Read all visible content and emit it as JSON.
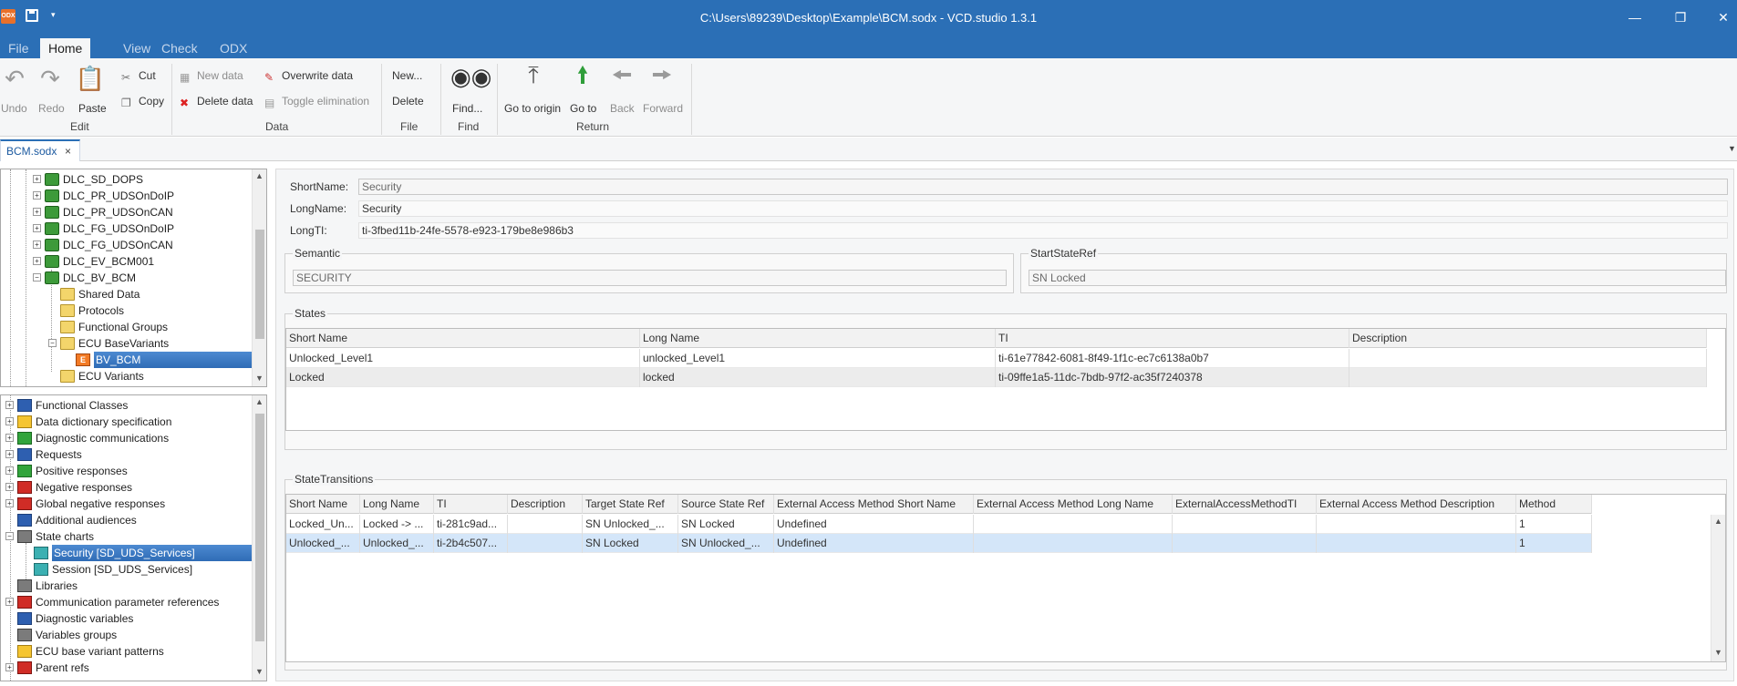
{
  "window": {
    "title": "C:\\Users\\89239\\Desktop\\Example\\BCM.sodx - VCD.studio 1.3.1",
    "icon_text": "ODX",
    "controls": [
      "minimize-icon",
      "restore-icon",
      "close-icon"
    ]
  },
  "menu": {
    "tabs": [
      "File",
      "Home",
      "View",
      "Check",
      "ODX"
    ],
    "active": "Home"
  },
  "ribbon": {
    "edit": {
      "label": "Edit",
      "undo": "Undo",
      "redo": "Redo",
      "paste": "Paste",
      "cut": "Cut",
      "copy": "Copy"
    },
    "data": {
      "label": "Data",
      "new_data": "New data",
      "delete_data": "Delete data",
      "overwrite_data": "Overwrite data",
      "toggle_elimination": "Toggle elimination"
    },
    "file": {
      "label": "File",
      "new": "New...",
      "delete": "Delete"
    },
    "find": {
      "label": "Find",
      "find": "Find..."
    },
    "return": {
      "label": "Return",
      "go_to_origin": "Go to origin",
      "go_to": "Go to",
      "back": "Back",
      "forward": "Forward"
    }
  },
  "doc_tab": {
    "label": "BCM.sodx",
    "close": "×"
  },
  "tree_top": {
    "items": [
      {
        "label": "DLC_SD_DOPS",
        "icon": "package-icon"
      },
      {
        "label": "DLC_PR_UDSOnDoIP",
        "icon": "package-icon"
      },
      {
        "label": "DLC_PR_UDSOnCAN",
        "icon": "package-icon"
      },
      {
        "label": "DLC_FG_UDSOnDoIP",
        "icon": "package-icon"
      },
      {
        "label": "DLC_FG_UDSOnCAN",
        "icon": "package-icon"
      },
      {
        "label": "DLC_EV_BCM001",
        "icon": "package-icon"
      },
      {
        "label": "DLC_BV_BCM",
        "icon": "package-icon"
      },
      {
        "label": "Shared Data",
        "icon": "folder-icon"
      },
      {
        "label": "Protocols",
        "icon": "folder-icon"
      },
      {
        "label": "Functional Groups",
        "icon": "folder-icon"
      },
      {
        "label": "ECU BaseVariants",
        "icon": "folder-icon"
      },
      {
        "label": "BV_BCM",
        "icon": "ecu-icon",
        "selected": true
      },
      {
        "label": "ECU Variants",
        "icon": "folder-icon"
      }
    ]
  },
  "tree_bottom": {
    "items": [
      {
        "label": "Functional Classes",
        "icon": "functional-classes-icon"
      },
      {
        "label": "Data dictionary specification",
        "icon": "data-dictionary-icon"
      },
      {
        "label": "Diagnostic communications",
        "icon": "diag-comm-icon"
      },
      {
        "label": "Requests",
        "icon": "request-icon"
      },
      {
        "label": "Positive responses",
        "icon": "positive-response-icon"
      },
      {
        "label": "Negative responses",
        "icon": "negative-response-icon"
      },
      {
        "label": "Global negative responses",
        "icon": "global-negative-icon"
      },
      {
        "label": "Additional audiences",
        "icon": "audiences-icon"
      },
      {
        "label": "State charts",
        "icon": "state-chart-icon"
      },
      {
        "label": "Security [SD_UDS_Services]",
        "icon": "state-chart-item-icon",
        "selected": true
      },
      {
        "label": "Session [SD_UDS_Services]",
        "icon": "state-chart-item-icon"
      },
      {
        "label": "Libraries",
        "icon": "library-icon"
      },
      {
        "label": "Communication parameter references",
        "icon": "comparam-icon"
      },
      {
        "label": "Diagnostic variables",
        "icon": "diag-variable-icon"
      },
      {
        "label": "Variables groups",
        "icon": "variable-group-icon"
      },
      {
        "label": "ECU base variant patterns",
        "icon": "variant-pattern-icon"
      },
      {
        "label": "Parent refs",
        "icon": "parent-ref-icon"
      }
    ]
  },
  "form": {
    "short_name_label": "ShortName:",
    "short_name": "Security",
    "long_name_label": "LongName:",
    "long_name": "Security",
    "long_ti_label": "LongTI:",
    "long_ti": "ti-3fbed11b-24fe-5578-e923-179be8e986b3",
    "semantic_label": "Semantic",
    "semantic": "SECURITY",
    "start_state_label": "StartStateRef",
    "start_state": "SN  Locked"
  },
  "states": {
    "label": "States",
    "columns": [
      "Short Name",
      "Long Name",
      "TI",
      "Description"
    ],
    "rows": [
      [
        "Unlocked_Level1",
        "unlocked_Level1",
        "ti-61e77842-6081-8f49-1f1c-ec7c6138a0b7",
        ""
      ],
      [
        "Locked",
        "locked",
        "ti-09ffe1a5-11dc-7bdb-97f2-ac35f7240378",
        ""
      ]
    ]
  },
  "transitions": {
    "label": "StateTransitions",
    "columns": [
      "Short Name",
      "Long Name",
      "TI",
      "Description",
      "Target State Ref",
      "Source State Ref",
      "External Access Method Short Name",
      "External Access Method Long Name",
      "ExternalAccessMethodTI",
      "External Access Method Description",
      "Method"
    ],
    "rows": [
      [
        "Locked_Un...",
        "Locked -> ...",
        "ti-281c9ad...",
        "",
        "SN  Unlocked_...",
        "SN  Locked",
        "Undefined",
        "",
        "",
        "",
        "1"
      ],
      [
        "Unlocked_...",
        "Unlocked_...",
        "ti-2b4c507...",
        "",
        "SN  Locked",
        "SN  Unlocked_...",
        "Undefined",
        "",
        "",
        "",
        "1"
      ]
    ]
  }
}
